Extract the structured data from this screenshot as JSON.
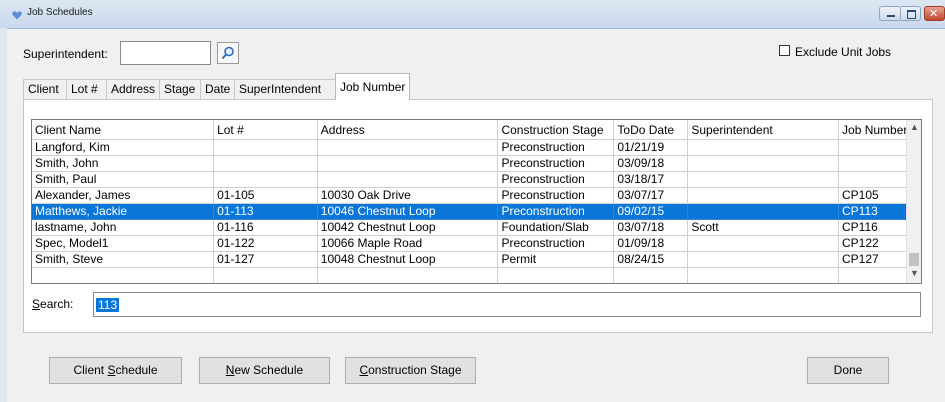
{
  "window": {
    "title": "Job Schedules"
  },
  "filter": {
    "superintendent_label": "Superintendent:",
    "superintendent_value": "",
    "exclude_unit_jobs_label": "Exclude Unit Jobs",
    "exclude_unit_jobs_checked": false
  },
  "tabs": [
    {
      "label": "Client",
      "active": false
    },
    {
      "label": "Lot #",
      "active": false
    },
    {
      "label": "Address",
      "active": false
    },
    {
      "label": "Stage",
      "active": false
    },
    {
      "label": "Date",
      "active": false
    },
    {
      "label": "SuperIntendent",
      "active": false
    },
    {
      "label": "Job Number",
      "active": true
    }
  ],
  "grid": {
    "columns": [
      "Client Name",
      "Lot #",
      "Address",
      "Construction Stage",
      "ToDo Date",
      "Superintendent",
      "Job Number"
    ],
    "rows": [
      [
        "Langford, Kim",
        "",
        "",
        "Preconstruction",
        "01/21/19",
        "",
        ""
      ],
      [
        "Smith, John",
        "",
        "",
        "Preconstruction",
        "03/09/18",
        "",
        ""
      ],
      [
        "Smith, Paul",
        "",
        "",
        "Preconstruction",
        "03/18/17",
        "",
        ""
      ],
      [
        "Alexander, James",
        "01-105",
        "10030 Oak Drive",
        "Preconstruction",
        "03/07/17",
        "",
        "CP105"
      ],
      [
        "Matthews, Jackie",
        "01-113",
        "10046 Chestnut Loop",
        "Preconstruction",
        "09/02/15",
        "",
        "CP113"
      ],
      [
        "lastname, John",
        "01-116",
        "10042 Chestnut Loop",
        "Foundation/Slab",
        "03/07/18",
        "Scott",
        "CP116"
      ],
      [
        "Spec, Model1",
        "01-122",
        "10066 Maple Road",
        "Preconstruction",
        "01/09/18",
        "",
        "CP122"
      ],
      [
        "Smith, Steve",
        "01-127",
        "10048 Chestnut Loop",
        "Permit",
        "08/24/15",
        "",
        "CP127"
      ],
      [
        "",
        "",
        "",
        "",
        "",
        "",
        ""
      ]
    ],
    "selected_row": 4
  },
  "search": {
    "label_prefix": "",
    "label_mnemonic": "S",
    "label_rest": "earch:",
    "value": "113"
  },
  "buttons": {
    "client_schedule": {
      "pre": "Client ",
      "mnemonic": "S",
      "post": "chedule"
    },
    "new_schedule": {
      "pre": "",
      "mnemonic": "N",
      "post": "ew Schedule"
    },
    "construction_stage": {
      "pre": "",
      "mnemonic": "C",
      "post": "onstruction Stage"
    },
    "done": {
      "label": "Done"
    }
  },
  "icons": {
    "app": "heart-app-icon",
    "search": "magnifier-icon"
  },
  "colors": {
    "selection": "#0a76d8",
    "titlebar": "#c9d9ec"
  }
}
